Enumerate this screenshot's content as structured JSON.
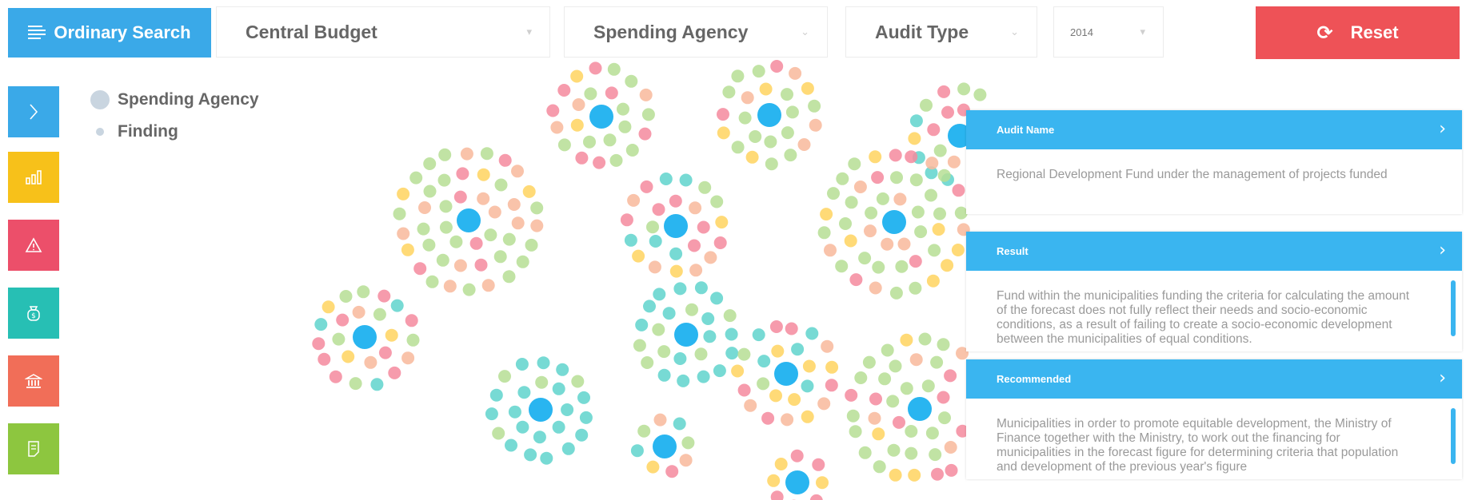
{
  "toolbar": {
    "search_label": "Ordinary Search",
    "budget_label": "Central Budget",
    "agency_label": "Spending Agency",
    "audit_type_label": "Audit Type",
    "year_label": "2014",
    "reset_label": "Reset"
  },
  "legend": {
    "agency": "Spending Agency",
    "finding": "Finding"
  },
  "sidebar": [
    {
      "name": "expand",
      "icon": "chevron-right-icon",
      "color": "#3aa9e8"
    },
    {
      "name": "chart",
      "icon": "bar-chart-icon",
      "color": "#f7c11a"
    },
    {
      "name": "warning",
      "icon": "warning-icon",
      "color": "#ec4f6a"
    },
    {
      "name": "money",
      "icon": "money-bag-icon",
      "color": "#27bfb4"
    },
    {
      "name": "bank",
      "icon": "bank-icon",
      "color": "#f16e58"
    },
    {
      "name": "document",
      "icon": "document-icon",
      "color": "#8dc63f"
    }
  ],
  "panels": {
    "audit_name": {
      "title": "Audit Name",
      "body": "Regional Development Fund under the management of projects funded"
    },
    "result": {
      "title": "Result",
      "body": "Fund within the municipalities funding the criteria for calculating the amount of the forecast does not fully reflect their needs and socio-economic conditions, as a result of failing to create a socio-economic development between the municipalities of equal conditions."
    },
    "recommended": {
      "title": "Recommended",
      "body": "Municipalities in order to promote equitable development, the Ministry of Finance together with the Ministry, to work out the financing for municipalities in the forecast figure for determining criteria that population and development of the previous year's figure"
    }
  },
  "colors": {
    "hub": "#29b5f0",
    "finding_green": "#b6de94",
    "finding_pink": "#f4899d",
    "finding_peach": "#f8b99b",
    "finding_yellow": "#ffd45f",
    "finding_teal": "#5fd3cc"
  }
}
